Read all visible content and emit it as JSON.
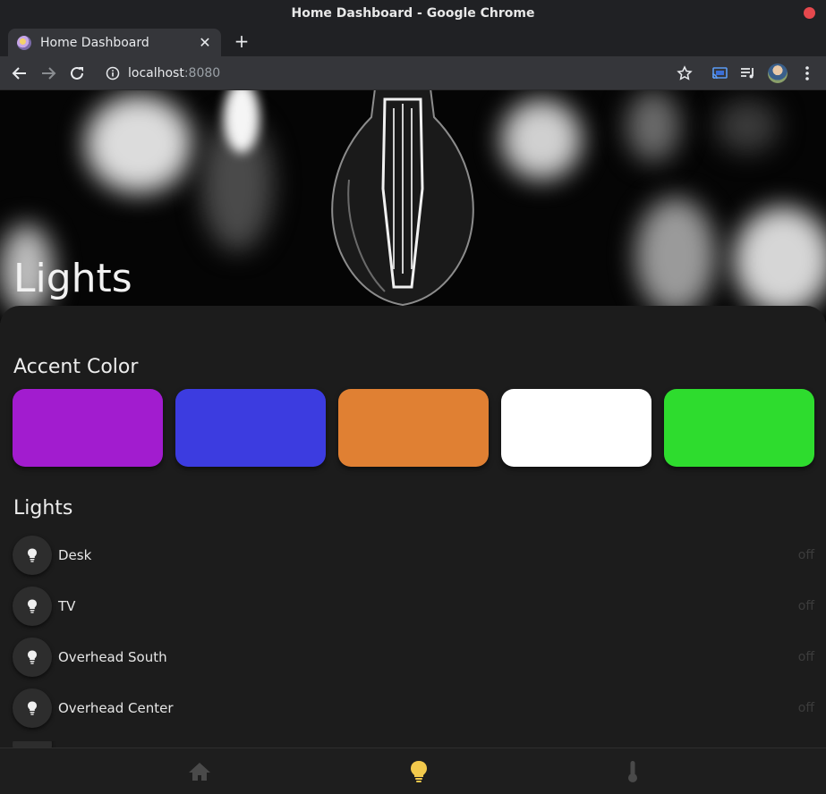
{
  "window": {
    "title": "Home Dashboard - Google Chrome"
  },
  "tab": {
    "title": "Home Dashboard",
    "close_glyph": "✕"
  },
  "toolbar": {
    "new_tab_glyph": "+",
    "url_host": "localhost",
    "url_port": ":8080"
  },
  "icons": {
    "back": "arrow-back-icon",
    "forward": "arrow-forward-icon",
    "reload": "reload-icon",
    "site_info": "info-icon",
    "bookmark": "star-icon",
    "cast": "cast-icon",
    "media": "playlist-icon",
    "profile": "avatar",
    "menu": "kebab-menu-icon"
  },
  "hero": {
    "title": "Lights"
  },
  "accent": {
    "title": "Accent Color",
    "colors": [
      "#a21ccf",
      "#3c3ce0",
      "#e08033",
      "#ffffff",
      "#2edc2e"
    ]
  },
  "lights": {
    "title": "Lights",
    "items": [
      {
        "name": "Desk",
        "state": "off"
      },
      {
        "name": "TV",
        "state": "off"
      },
      {
        "name": "Overhead South",
        "state": "off"
      },
      {
        "name": "Overhead Center",
        "state": "off"
      }
    ]
  },
  "nav": {
    "items": [
      {
        "icon": "home-icon",
        "active": false
      },
      {
        "icon": "lightbulb-icon",
        "active": true
      },
      {
        "icon": "thermometer-icon",
        "active": false
      }
    ],
    "active_color": "#f2c94c",
    "inactive_color": "#4a4a4a"
  }
}
